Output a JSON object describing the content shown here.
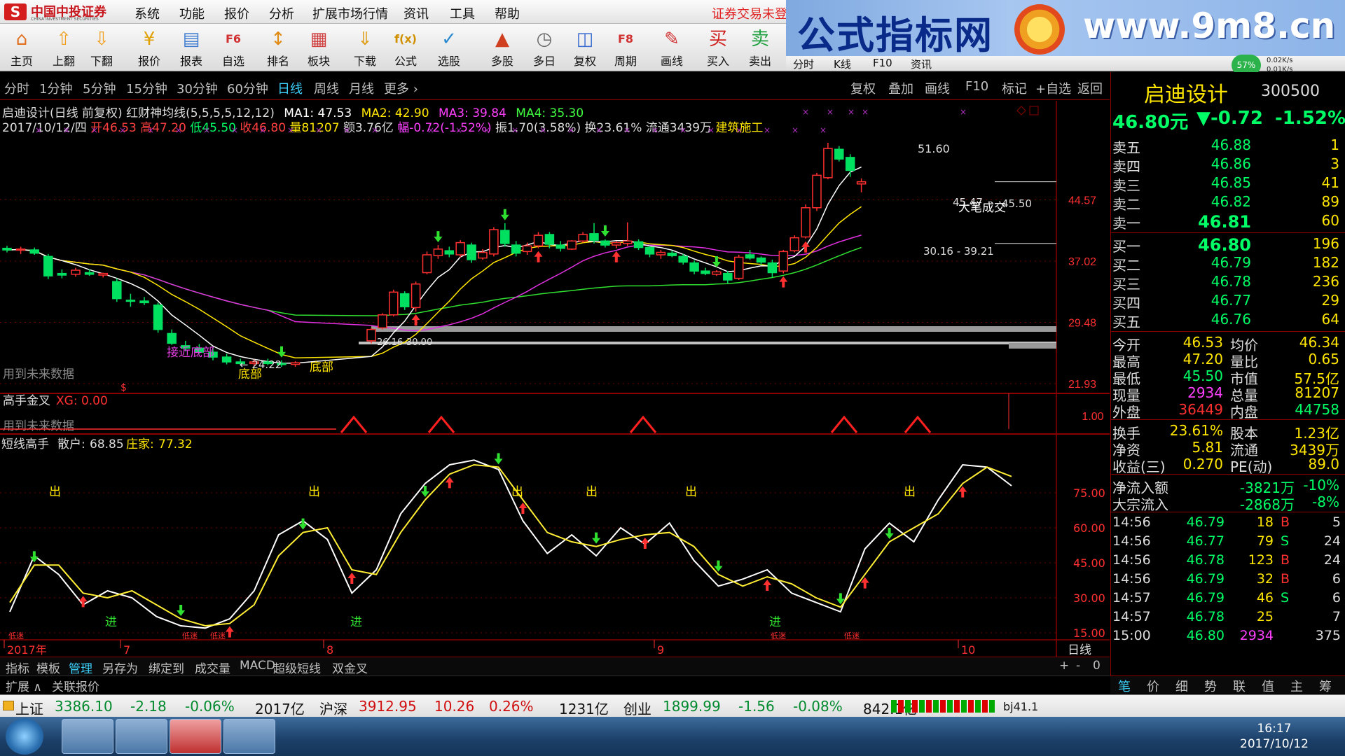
{
  "menubar": {
    "logo_cn": "中国中投证券",
    "logo_en": "CHINA INVESTMENT SECURITIES",
    "items": [
      "系统",
      "功能",
      "报价",
      "分析",
      "扩展市场行情",
      "资讯",
      "工具",
      "帮助"
    ],
    "notice": "证券交易未登"
  },
  "banner": {
    "title": "公式指标网",
    "url": "www.9m8.cn"
  },
  "toolbar": {
    "buttons": [
      {
        "label": "主页",
        "icon": "home-icon",
        "glyph": "⌂",
        "color": "#e07020"
      },
      {
        "label": "上翻",
        "icon": "up-arrow-icon",
        "glyph": "⇧",
        "color": "#f0a020"
      },
      {
        "label": "下翻",
        "icon": "down-arrow-icon",
        "glyph": "⇩",
        "color": "#f0a020"
      },
      {
        "label": "报价",
        "icon": "quote-icon",
        "glyph": "¥",
        "color": "#e0a000"
      },
      {
        "label": "报表",
        "icon": "report-icon",
        "glyph": "▤",
        "color": "#3a7ad0"
      },
      {
        "label": "自选",
        "icon": "favorites-icon",
        "glyph": "F6",
        "color": "#d03030"
      },
      {
        "label": "排名",
        "icon": "ranking-icon",
        "glyph": "↕",
        "color": "#e08a10"
      },
      {
        "label": "板块",
        "icon": "sector-icon",
        "glyph": "▦",
        "color": "#d04040"
      },
      {
        "label": "下载",
        "icon": "download-icon",
        "glyph": "⇓",
        "color": "#e0a020"
      },
      {
        "label": "公式",
        "icon": "formula-icon",
        "glyph": "f(x)",
        "color": "#d09000"
      },
      {
        "label": "选股",
        "icon": "stock-picker-icon",
        "glyph": "✓",
        "color": "#2a8ad0"
      },
      {
        "label": "多股",
        "icon": "multi-stock-icon",
        "glyph": "▲",
        "color": "#d04020"
      },
      {
        "label": "多日",
        "icon": "multi-day-icon",
        "glyph": "◷",
        "color": "#666"
      },
      {
        "label": "复权",
        "icon": "restore-rights-icon",
        "glyph": "◫",
        "color": "#3a6ad0"
      },
      {
        "label": "周期",
        "icon": "period-icon",
        "glyph": "F8",
        "color": "#d03030"
      },
      {
        "label": "画线",
        "icon": "draw-line-icon",
        "glyph": "✎",
        "color": "#d03030"
      },
      {
        "label": "买入",
        "icon": "buy-icon",
        "glyph": "买",
        "color": "#d02020"
      },
      {
        "label": "卖出",
        "icon": "sell-icon",
        "glyph": "卖",
        "color": "#20a040"
      }
    ],
    "secondary": [
      "分时",
      "K线",
      "F10",
      "资讯"
    ],
    "gauge": "57%",
    "speed_up": "0.02K/s",
    "speed_down": "0.01K/s"
  },
  "periods": [
    "分时",
    "1分钟",
    "5分钟",
    "15分钟",
    "30分钟",
    "60分钟",
    "日线",
    "周线",
    "月线",
    "更多 ›"
  ],
  "selected_period": "日线",
  "chart_tools": [
    "复权",
    "叠加",
    "画线",
    "F10",
    "标记",
    "+自选",
    "返回"
  ],
  "info": {
    "line1": {
      "title": "启迪设计(日线 前复权) 红财神均线(5,5,5,5,12,12)",
      "ma1": "MA1: 47.53",
      "ma2": "MA2: 42.90",
      "ma3": "MA3: 39.84",
      "ma4": "MA4: 35.30"
    },
    "line2": {
      "date": "2017/10/12/四",
      "open": "开46.53",
      "high": "高47.20",
      "low": "低45.50",
      "close": "收46.80",
      "vol": "量81207",
      "amt": "额3.76亿",
      "amp_chg": "幅-0.72(-1.52%)",
      "swing": "振1.70(3.58%)",
      "turnover": "换23.61%",
      "float": "流通3439万",
      "industry": "建筑施工"
    }
  },
  "price_axis": [
    "44.57",
    "37.02",
    "29.48",
    "21.93",
    "1.00"
  ],
  "chart_data": [
    {
      "type": "candlestick",
      "title": "启迪设计(日线 前复权)",
      "x_label_months": [
        "2017年",
        "7",
        "8",
        "9",
        "10"
      ],
      "ylim": [
        21.93,
        52.0
      ],
      "annotations": [
        "51.60",
        "45.47",
        "45.50",
        "大笔成交",
        "30.16 - 39.21",
        "← 24.22",
        "26.16",
        "30.00",
        "接近底部",
        "底部",
        "底部",
        "用到未来数据"
      ],
      "candles": [
        {
          "o": 38.6,
          "h": 38.9,
          "l": 38.1,
          "c": 38.4
        },
        {
          "o": 38.4,
          "h": 38.8,
          "l": 37.9,
          "c": 38.5
        },
        {
          "o": 38.4,
          "h": 38.7,
          "l": 37.8,
          "c": 38.0
        },
        {
          "o": 37.6,
          "h": 37.9,
          "l": 34.8,
          "c": 35.2
        },
        {
          "o": 35.5,
          "h": 36.0,
          "l": 34.9,
          "c": 35.3
        },
        {
          "o": 35.4,
          "h": 36.2,
          "l": 35.1,
          "c": 35.9
        },
        {
          "o": 35.6,
          "h": 36.0,
          "l": 35.2,
          "c": 35.4
        },
        {
          "o": 35.3,
          "h": 35.6,
          "l": 35.0,
          "c": 35.5
        },
        {
          "o": 34.5,
          "h": 34.9,
          "l": 32.0,
          "c": 32.4
        },
        {
          "o": 32.2,
          "h": 33.0,
          "l": 31.4,
          "c": 32.1
        },
        {
          "o": 32.1,
          "h": 32.6,
          "l": 31.6,
          "c": 31.9
        },
        {
          "o": 31.6,
          "h": 31.9,
          "l": 28.2,
          "c": 28.6
        },
        {
          "o": 28.1,
          "h": 28.6,
          "l": 26.7,
          "c": 26.9
        },
        {
          "o": 26.6,
          "h": 27.2,
          "l": 25.9,
          "c": 26.3
        },
        {
          "o": 26.3,
          "h": 26.8,
          "l": 25.6,
          "c": 25.8
        },
        {
          "o": 25.8,
          "h": 26.3,
          "l": 24.8,
          "c": 25.2
        },
        {
          "o": 25.2,
          "h": 25.6,
          "l": 24.3,
          "c": 24.6
        },
        {
          "o": 24.6,
          "h": 25.0,
          "l": 24.2,
          "c": 24.4
        },
        {
          "o": 24.4,
          "h": 24.9,
          "l": 24.1,
          "c": 24.6
        },
        {
          "o": 24.6,
          "h": 25.0,
          "l": 24.2,
          "c": 24.4
        },
        {
          "o": 24.4,
          "h": 24.8,
          "l": 24.0,
          "c": 24.3
        },
        {
          "o": 24.3,
          "h": 24.7,
          "l": 24.0,
          "c": 24.5
        },
        {
          "o": 27.2,
          "h": 28.8,
          "l": 26.9,
          "c": 28.6
        },
        {
          "o": 28.8,
          "h": 30.6,
          "l": 28.6,
          "c": 30.4
        },
        {
          "o": 30.4,
          "h": 33.5,
          "l": 30.2,
          "c": 33.2
        },
        {
          "o": 33.0,
          "h": 33.3,
          "l": 31.0,
          "c": 31.4
        },
        {
          "o": 31.3,
          "h": 34.5,
          "l": 30.8,
          "c": 34.2
        },
        {
          "o": 35.6,
          "h": 38.2,
          "l": 35.4,
          "c": 37.8
        },
        {
          "o": 37.7,
          "h": 39.0,
          "l": 37.3,
          "c": 38.5
        },
        {
          "o": 38.3,
          "h": 38.8,
          "l": 37.5,
          "c": 37.9
        },
        {
          "o": 37.8,
          "h": 39.6,
          "l": 37.5,
          "c": 39.3
        },
        {
          "o": 39.0,
          "h": 39.3,
          "l": 36.8,
          "c": 37.2
        },
        {
          "o": 37.4,
          "h": 38.5,
          "l": 37.2,
          "c": 38.1
        },
        {
          "o": 37.9,
          "h": 41.2,
          "l": 37.6,
          "c": 40.9
        },
        {
          "o": 40.8,
          "h": 41.7,
          "l": 38.8,
          "c": 39.2
        },
        {
          "o": 39.0,
          "h": 39.5,
          "l": 37.6,
          "c": 38.0
        },
        {
          "o": 38.2,
          "h": 39.3,
          "l": 37.8,
          "c": 38.9
        },
        {
          "o": 38.9,
          "h": 40.6,
          "l": 38.6,
          "c": 40.2
        },
        {
          "o": 40.3,
          "h": 40.6,
          "l": 38.6,
          "c": 39.1
        },
        {
          "o": 39.0,
          "h": 39.5,
          "l": 38.2,
          "c": 38.6
        },
        {
          "o": 38.5,
          "h": 39.6,
          "l": 38.4,
          "c": 39.5
        },
        {
          "o": 39.5,
          "h": 40.6,
          "l": 39.3,
          "c": 40.3
        },
        {
          "o": 40.4,
          "h": 41.7,
          "l": 39.2,
          "c": 39.6
        },
        {
          "o": 39.5,
          "h": 39.7,
          "l": 38.7,
          "c": 39.0
        },
        {
          "o": 39.0,
          "h": 39.5,
          "l": 38.6,
          "c": 39.3
        },
        {
          "o": 39.2,
          "h": 41.8,
          "l": 38.9,
          "c": 39.5
        },
        {
          "o": 39.4,
          "h": 39.7,
          "l": 38.4,
          "c": 38.7
        },
        {
          "o": 38.7,
          "h": 38.9,
          "l": 37.5,
          "c": 37.9
        },
        {
          "o": 37.8,
          "h": 38.4,
          "l": 37.3,
          "c": 38.1
        },
        {
          "o": 38.0,
          "h": 38.3,
          "l": 37.5,
          "c": 37.7
        },
        {
          "o": 37.6,
          "h": 37.9,
          "l": 36.6,
          "c": 36.9
        },
        {
          "o": 36.8,
          "h": 37.1,
          "l": 35.4,
          "c": 35.8
        },
        {
          "o": 35.8,
          "h": 36.2,
          "l": 35.3,
          "c": 35.5
        },
        {
          "o": 35.4,
          "h": 35.9,
          "l": 35.2,
          "c": 35.7
        },
        {
          "o": 35.5,
          "h": 35.8,
          "l": 34.3,
          "c": 34.7
        },
        {
          "o": 34.9,
          "h": 37.8,
          "l": 34.7,
          "c": 37.5
        },
        {
          "o": 37.8,
          "h": 38.4,
          "l": 37.2,
          "c": 37.4
        },
        {
          "o": 37.4,
          "h": 37.6,
          "l": 36.5,
          "c": 36.9
        },
        {
          "o": 36.8,
          "h": 37.2,
          "l": 35.0,
          "c": 35.6
        },
        {
          "o": 35.8,
          "h": 38.4,
          "l": 35.5,
          "c": 38.2
        },
        {
          "o": 38.3,
          "h": 40.2,
          "l": 38.1,
          "c": 39.9
        },
        {
          "o": 40.0,
          "h": 44.0,
          "l": 39.8,
          "c": 43.6
        },
        {
          "o": 43.6,
          "h": 47.9,
          "l": 43.2,
          "c": 47.6
        },
        {
          "o": 47.3,
          "h": 51.6,
          "l": 47.1,
          "c": 50.9
        },
        {
          "o": 50.8,
          "h": 51.2,
          "l": 49.3,
          "c": 49.6
        },
        {
          "o": 49.8,
          "h": 50.2,
          "l": 47.4,
          "c": 48.2
        },
        {
          "o": 46.53,
          "h": 47.2,
          "l": 45.5,
          "c": 46.8
        }
      ]
    },
    {
      "type": "line",
      "title": "短线高手",
      "ylim": [
        15,
        90
      ],
      "y_ticks": [
        "75.00",
        "60.00",
        "45.00",
        "30.00",
        "15.00"
      ],
      "series": [
        {
          "name": "散户",
          "value_label": "68.85",
          "color": "#ffffff",
          "values": [
            24,
            48,
            40,
            27,
            33,
            30,
            22,
            18,
            17,
            21,
            33,
            57,
            63,
            55,
            32,
            42,
            66,
            79,
            87,
            89,
            85,
            63,
            49,
            57,
            48,
            60,
            53,
            62,
            46,
            35,
            38,
            42,
            32,
            28,
            24,
            51,
            62,
            54,
            72,
            87,
            86,
            78
          ]
        },
        {
          "name": "庄家",
          "value_label": "77.32",
          "color": "#ffee33",
          "values": [
            28,
            44,
            44,
            32,
            30,
            33,
            27,
            21,
            18,
            19,
            27,
            48,
            58,
            60,
            42,
            40,
            58,
            72,
            83,
            87,
            86,
            72,
            58,
            54,
            52,
            55,
            57,
            58,
            52,
            40,
            35,
            39,
            36,
            30,
            26,
            40,
            54,
            60,
            66,
            79,
            86,
            82
          ]
        }
      ],
      "labels": [
        "出",
        "出",
        "出",
        "出",
        "出",
        "出",
        "进",
        "进",
        "进",
        "低迷",
        "低迷",
        "低迷",
        "低迷"
      ]
    }
  ],
  "indicator2": {
    "title": "高手金叉",
    "xg": "XG: 0.00",
    "note": "用到未来数据"
  },
  "bottom_tabs": [
    "指标",
    "模板",
    "管理",
    "另存为",
    "绑定到",
    "成交量",
    "MACD",
    "超级短线",
    "双金叉"
  ],
  "bottom_tabs_right": [
    "+",
    "-",
    "0"
  ],
  "extend": [
    "扩展 ∧",
    "关联报价"
  ],
  "period_label": "日线",
  "right_panel": {
    "name": "启迪设计",
    "code": "300500",
    "price": "46.80元",
    "change": "▼-0.72",
    "pct": "-1.52%",
    "asks": [
      {
        "l": "卖五",
        "p": "46.88",
        "v": "1"
      },
      {
        "l": "卖四",
        "p": "46.86",
        "v": "3"
      },
      {
        "l": "卖三",
        "p": "46.85",
        "v": "41"
      },
      {
        "l": "卖二",
        "p": "46.82",
        "v": "89"
      },
      {
        "l": "卖一",
        "p": "46.81",
        "v": "60"
      }
    ],
    "bids": [
      {
        "l": "买一",
        "p": "46.80",
        "v": "196"
      },
      {
        "l": "买二",
        "p": "46.79",
        "v": "182"
      },
      {
        "l": "买三",
        "p": "46.78",
        "v": "236"
      },
      {
        "l": "买四",
        "p": "46.77",
        "v": "29"
      },
      {
        "l": "买五",
        "p": "46.76",
        "v": "64"
      }
    ],
    "stats1": [
      [
        "今开",
        "46.53",
        "均价",
        "46.34"
      ],
      [
        "最高",
        "47.20",
        "量比",
        "0.65"
      ],
      [
        "最低",
        "45.50",
        "市值",
        "57.5亿"
      ],
      [
        "现量",
        "2934",
        "总量",
        "81207"
      ],
      [
        "外盘",
        "36449",
        "内盘",
        "44758"
      ]
    ],
    "stats2": [
      [
        "换手",
        "23.61%",
        "股本",
        "1.23亿"
      ],
      [
        "净资",
        "5.81",
        "流通",
        "3439万"
      ],
      [
        "收益(三)",
        "0.270",
        "PE(动)",
        "89.0"
      ]
    ],
    "flows": [
      [
        "净流入额",
        "-3821万",
        "-10%"
      ],
      [
        "大宗流入",
        "-2868万",
        "-8%"
      ]
    ],
    "ticks": [
      [
        "14:56",
        "46.79",
        "18",
        "B",
        "5"
      ],
      [
        "14:56",
        "46.77",
        "79",
        "S",
        "24"
      ],
      [
        "14:56",
        "46.78",
        "123",
        "B",
        "24"
      ],
      [
        "14:56",
        "46.79",
        "32",
        "B",
        "6"
      ],
      [
        "14:57",
        "46.79",
        "46",
        "S",
        "6"
      ],
      [
        "14:57",
        "46.78",
        "25",
        "",
        "7"
      ],
      [
        "15:00",
        "46.80",
        "2934",
        "",
        "375"
      ]
    ],
    "tabs": [
      "笔",
      "价",
      "细",
      "势",
      "联",
      "值",
      "主",
      "筹"
    ]
  },
  "index_bar": [
    {
      "name": "上证",
      "val": "3386.10",
      "chg": "-2.18",
      "pct": "-0.06%",
      "amt": "2017亿"
    },
    {
      "name": "沪深",
      "val": "3912.95",
      "chg": "10.26",
      "pct": "0.26%",
      "amt": "1231亿"
    },
    {
      "name": "创业",
      "val": "1899.99",
      "chg": "-1.56",
      "pct": "-0.08%",
      "amt": "842.1亿"
    }
  ],
  "index_server": "bj41.1",
  "taskbar": {
    "time": "16:17",
    "date": "2017/10/12"
  }
}
